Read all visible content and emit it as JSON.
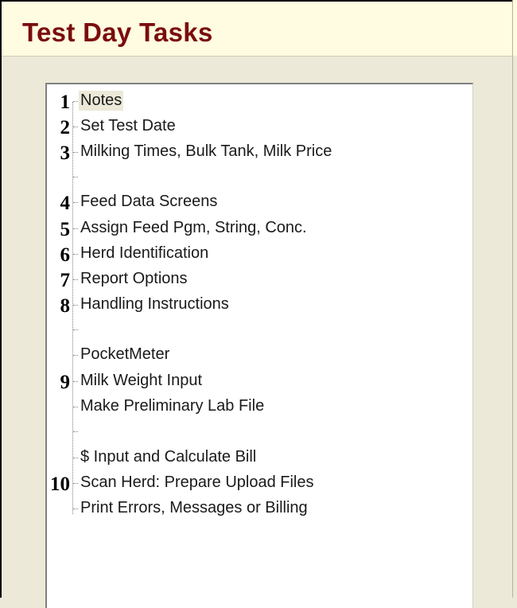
{
  "window": {
    "title": "Test Day Tasks"
  },
  "tree": {
    "items": [
      {
        "num": "1",
        "label": "Notes"
      },
      {
        "num": "2",
        "label": "Set Test Date"
      },
      {
        "num": "3",
        "label": "Milking Times, Bulk Tank, Milk Price"
      },
      {
        "num": "",
        "label": ""
      },
      {
        "num": "4",
        "label": "Feed Data Screens"
      },
      {
        "num": "5",
        "label": "Assign Feed Pgm, String, Conc."
      },
      {
        "num": "6",
        "label": "Herd Identification"
      },
      {
        "num": "7",
        "label": "Report Options"
      },
      {
        "num": "8",
        "label": "Handling Instructions"
      },
      {
        "num": "",
        "label": ""
      },
      {
        "num": "",
        "label": "PocketMeter"
      },
      {
        "num": "9",
        "label": "Milk Weight Input"
      },
      {
        "num": "",
        "label": "Make Preliminary Lab File"
      },
      {
        "num": "",
        "label": ""
      },
      {
        "num": "",
        "label": "$ Input and Calculate Bill"
      },
      {
        "num": "10",
        "label": "Scan Herd: Prepare Upload Files"
      },
      {
        "num": "",
        "label": "Print Errors, Messages or Billing"
      }
    ]
  }
}
